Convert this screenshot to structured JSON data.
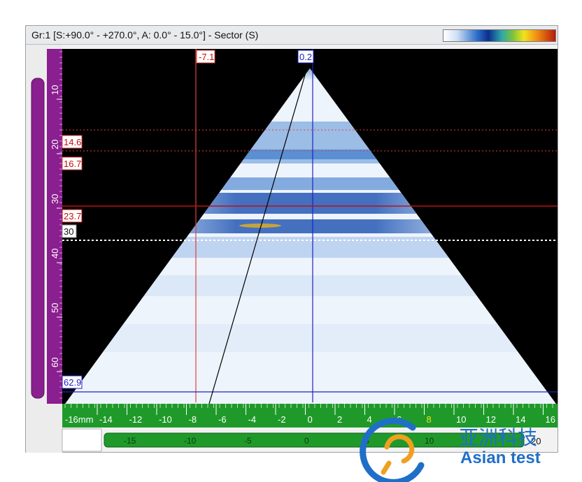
{
  "window": {
    "title": "Gr:1 [S:+90.0° - +270.0°, A: 0.0° - 15.0°] - Sector (S)"
  },
  "palette": {
    "colors": [
      "#ffffff",
      "#cfe0f5",
      "#2e6fc8",
      "#0a2f8f",
      "#2fa8a8",
      "#7cc43a",
      "#f2e21c",
      "#f08a12",
      "#b81a10"
    ]
  },
  "cursors": {
    "ref_x_label": "-7.1",
    "meas_x_label": "0.2",
    "depth_labels": [
      "14.6",
      "16.7",
      "23.7",
      "30",
      "62.9"
    ]
  },
  "depth_ruler": {
    "ticks": [
      "10",
      "20",
      "30",
      "40",
      "50",
      "60"
    ]
  },
  "bottom_ruler": {
    "unit_label": "-16mm",
    "ticks": [
      "-14",
      "-12",
      "-10",
      "-8",
      "-6",
      "-4",
      "-2",
      "0",
      "2",
      "4",
      "6",
      "8",
      "10",
      "12",
      "14",
      "16"
    ]
  },
  "lower_ruler": {
    "ticks": [
      "-15",
      "-10",
      "-5",
      "0",
      "5",
      "10"
    ],
    "end_value": "20"
  },
  "watermark": {
    "text_cn": "亚洲科技",
    "text_en": "Asian test"
  }
}
